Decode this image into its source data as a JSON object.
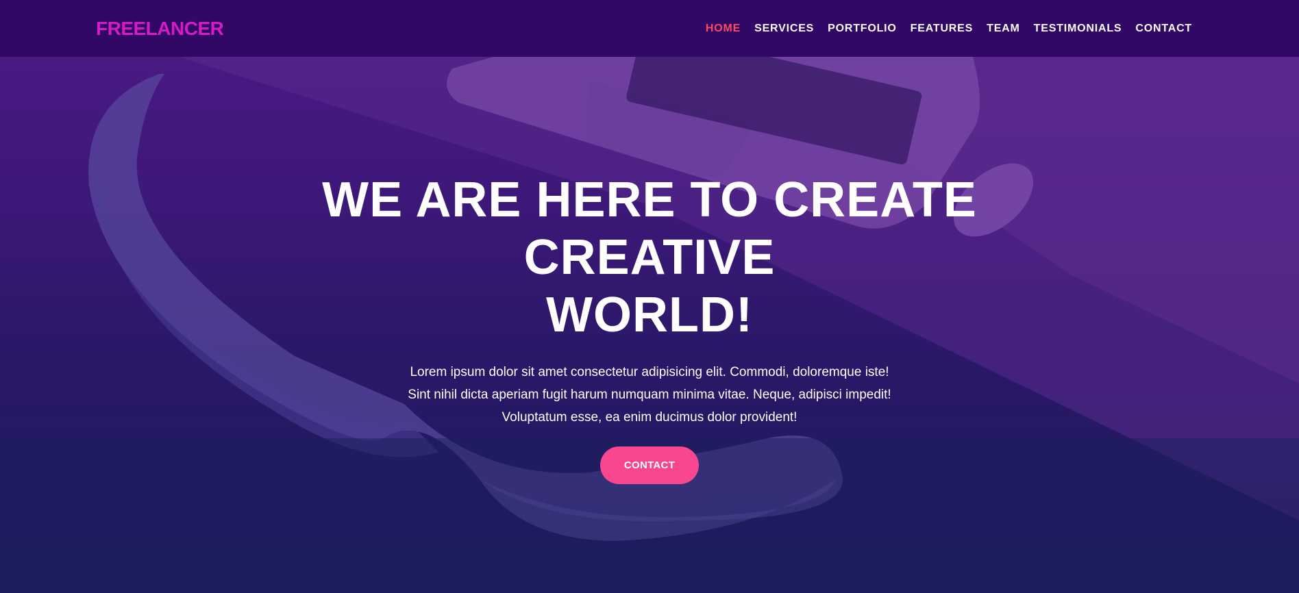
{
  "brand": {
    "name": "FREELANCER",
    "color": "#d41bc4"
  },
  "nav": {
    "items": [
      {
        "label": "HOME",
        "active": true
      },
      {
        "label": "SERVICES",
        "active": false
      },
      {
        "label": "PORTFOLIO",
        "active": false
      },
      {
        "label": "FEATURES",
        "active": false
      },
      {
        "label": "TEAM",
        "active": false
      },
      {
        "label": "TESTIMONIALS",
        "active": false
      },
      {
        "label": "CONTACT",
        "active": false
      }
    ]
  },
  "hero": {
    "title_line1": "WE ARE HERE TO CREATE CREATIVE",
    "title_line2": "WORLD!",
    "text_line1": "Lorem ipsum dolor sit amet consectetur adipisicing elit. Commodi, doloremque iste!",
    "text_line2": "Sint nihil dicta aperiam fugit harum numquam minima vitae. Neque, adipisci impedit!",
    "text_line3": "Voluptatum esse, ea enim ducimus dolor provident!",
    "button_label": "CONTACT"
  },
  "colors": {
    "navbar_bg": "#310866",
    "active_link": "#ff4a5e",
    "button_bg": "#f8468f"
  }
}
